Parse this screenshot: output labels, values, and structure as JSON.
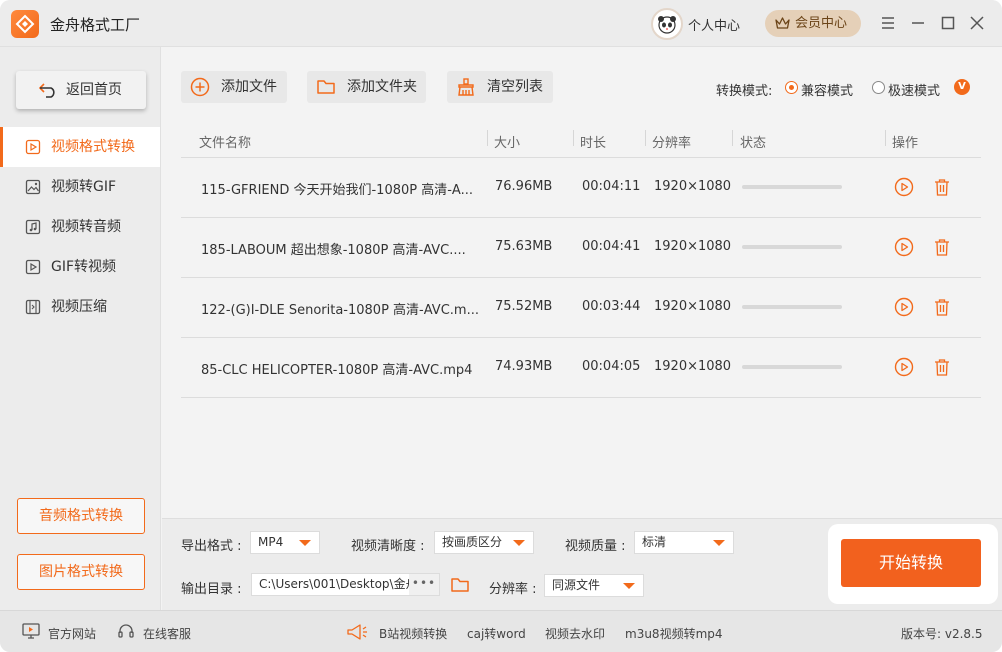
{
  "app": {
    "title": "金舟格式工厂",
    "user_center": "个人中心",
    "vip_center": "会员中心",
    "accent_color": "#f26a1b"
  },
  "sidebar": {
    "home": "返回首页",
    "items": [
      {
        "label": "视频格式转换",
        "icon": "video-convert-icon",
        "active": true
      },
      {
        "label": "视频转GIF",
        "icon": "image-icon",
        "active": false
      },
      {
        "label": "视频转音频",
        "icon": "music-icon",
        "active": false
      },
      {
        "label": "GIF转视频",
        "icon": "gif-video-icon",
        "active": false
      },
      {
        "label": "视频压缩",
        "icon": "compress-icon",
        "active": false
      }
    ],
    "audio_convert": "音频格式转换",
    "image_convert": "图片格式转换"
  },
  "toolbar": {
    "add_file": "添加文件",
    "add_folder": "添加文件夹",
    "clear_list": "清空列表",
    "mode_label": "转换模式:",
    "mode_compat": "兼容模式",
    "mode_fast": "极速模式",
    "vip_badge": "V",
    "selected_mode": "兼容模式"
  },
  "table": {
    "headers": {
      "name": "文件名称",
      "size": "大小",
      "duration": "时长",
      "resolution": "分辨率",
      "status": "状态",
      "actions": "操作"
    },
    "rows": [
      {
        "name": "115-GFRIEND 今天开始我们-1080P 高清-A...",
        "size": "76.96MB",
        "duration": "00:04:11",
        "resolution": "1920×1080",
        "progress": 0
      },
      {
        "name": "185-LABOUM 超出想象-1080P 高清-AVC....",
        "size": "75.63MB",
        "duration": "00:04:41",
        "resolution": "1920×1080",
        "progress": 0
      },
      {
        "name": "122-(G)I-DLE Senorita-1080P 高清-AVC.m...",
        "size": "75.52MB",
        "duration": "00:03:44",
        "resolution": "1920×1080",
        "progress": 0
      },
      {
        "name": "85-CLC HELICOPTER-1080P 高清-AVC.mp4",
        "size": "74.93MB",
        "duration": "00:04:05",
        "resolution": "1920×1080",
        "progress": 0
      }
    ]
  },
  "settings": {
    "output_format_label": "导出格式 :",
    "output_format": "MP4",
    "clarity_label": "视频清晰度 :",
    "clarity": "按画质区分",
    "quality_label": "视频质量 :",
    "quality": "标清",
    "output_dir_label": "输出目录 :",
    "output_dir": "C:\\Users\\001\\Desktop\\金舟",
    "more_dots": "•••",
    "resolution_label": "分辨率 :",
    "resolution": "同源文件",
    "start_button": "开始转换"
  },
  "footer": {
    "official_site": "官方网站",
    "online_service": "在线客服",
    "links": [
      "B站视频转换",
      "caj转word",
      "视频去水印",
      "m3u8视频转mp4"
    ],
    "version": "版本号: v2.8.5"
  }
}
